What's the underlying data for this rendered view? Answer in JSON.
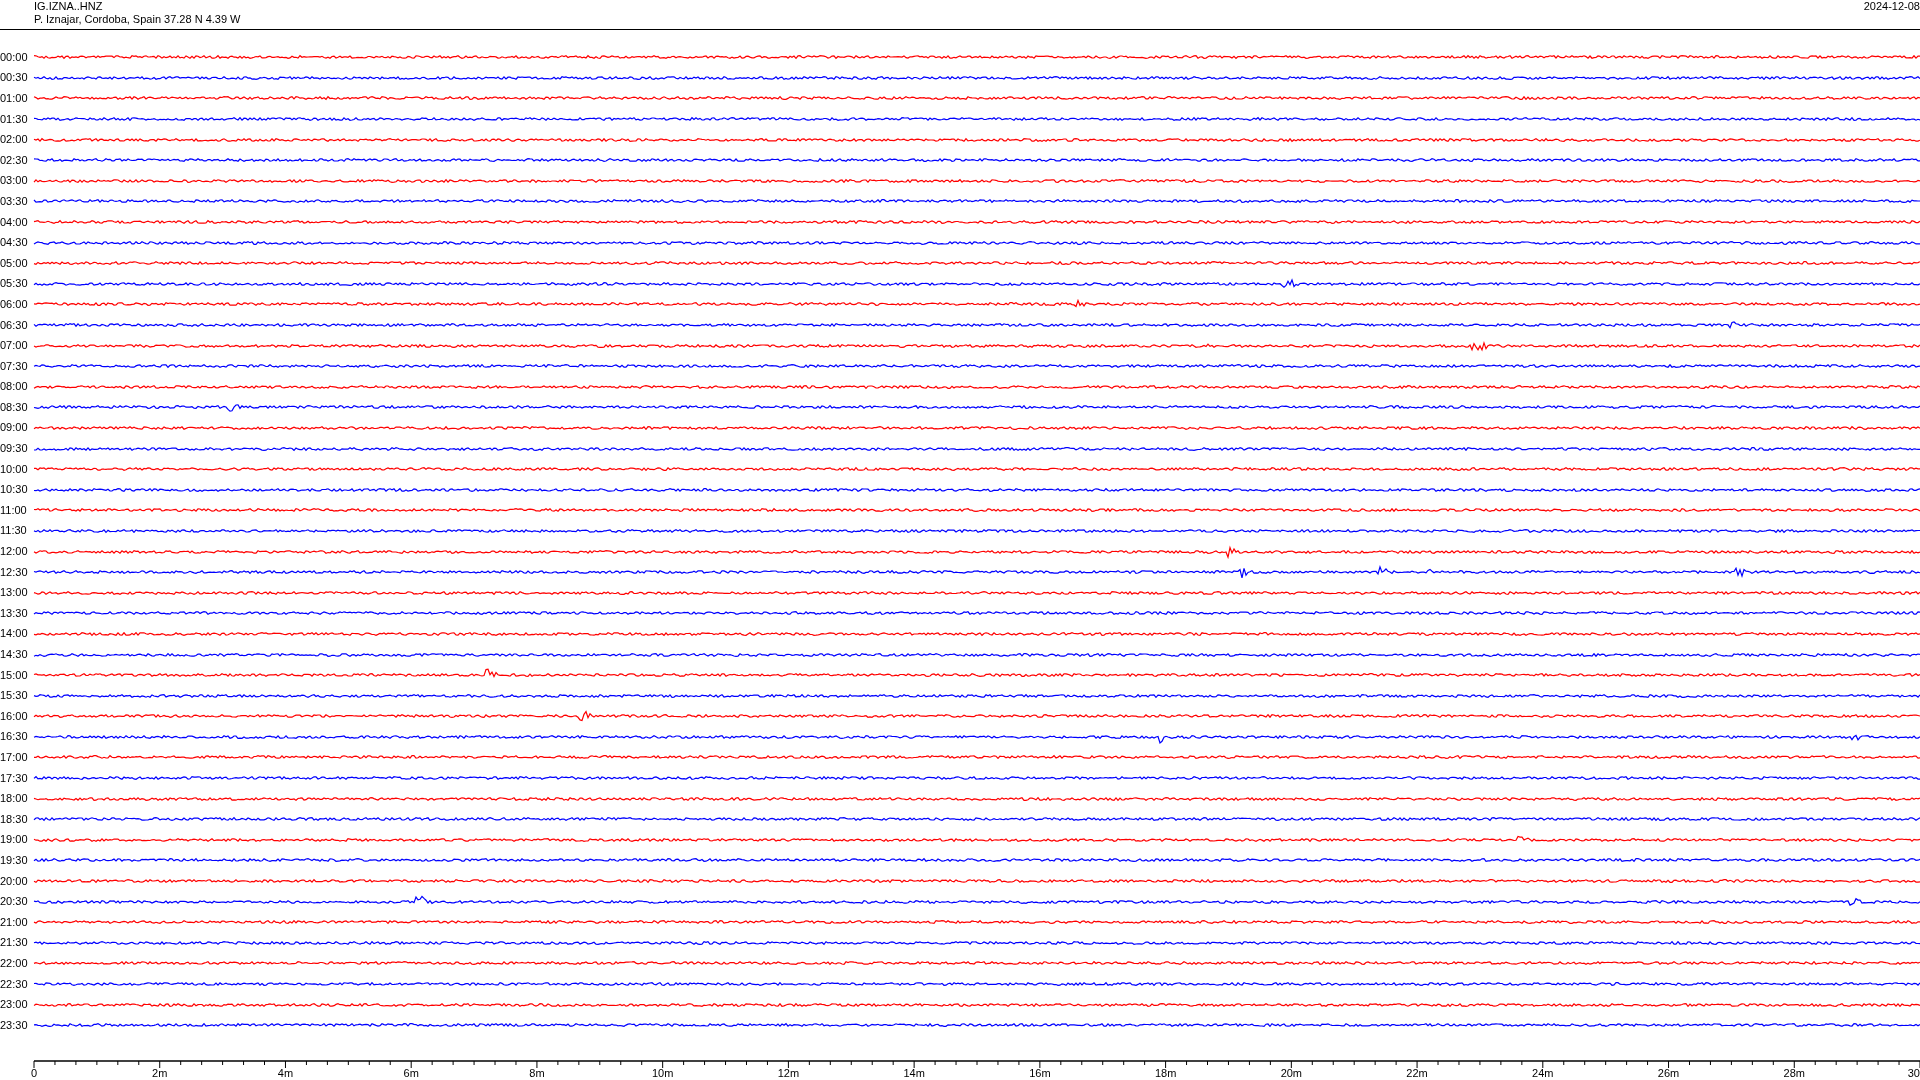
{
  "header": {
    "station": "IG.IZNA..HNZ",
    "location": "P. Iznajar, Cordoba, Spain  37.28 N 4.39 W",
    "date": "2024-12-08"
  },
  "rows": [
    {
      "label": "00:00",
      "color": "#ff0000"
    },
    {
      "label": "00:30",
      "color": "#0000ff"
    },
    {
      "label": "01:00",
      "color": "#ff0000"
    },
    {
      "label": "01:30",
      "color": "#0000ff"
    },
    {
      "label": "02:00",
      "color": "#ff0000"
    },
    {
      "label": "02:30",
      "color": "#0000ff"
    },
    {
      "label": "03:00",
      "color": "#ff0000"
    },
    {
      "label": "03:30",
      "color": "#0000ff"
    },
    {
      "label": "04:00",
      "color": "#ff0000"
    },
    {
      "label": "04:30",
      "color": "#0000ff"
    },
    {
      "label": "05:00",
      "color": "#ff0000"
    },
    {
      "label": "05:30",
      "color": "#0000ff"
    },
    {
      "label": "06:00",
      "color": "#ff0000"
    },
    {
      "label": "06:30",
      "color": "#0000ff"
    },
    {
      "label": "07:00",
      "color": "#ff0000"
    },
    {
      "label": "07:30",
      "color": "#0000ff"
    },
    {
      "label": "08:00",
      "color": "#ff0000"
    },
    {
      "label": "08:30",
      "color": "#0000ff"
    },
    {
      "label": "09:00",
      "color": "#ff0000"
    },
    {
      "label": "09:30",
      "color": "#0000ff"
    },
    {
      "label": "10:00",
      "color": "#ff0000"
    },
    {
      "label": "10:30",
      "color": "#0000ff"
    },
    {
      "label": "11:00",
      "color": "#ff0000"
    },
    {
      "label": "11:30",
      "color": "#0000ff"
    },
    {
      "label": "12:00",
      "color": "#ff0000"
    },
    {
      "label": "12:30",
      "color": "#0000ff"
    },
    {
      "label": "13:00",
      "color": "#ff0000"
    },
    {
      "label": "13:30",
      "color": "#0000ff"
    },
    {
      "label": "14:00",
      "color": "#ff0000"
    },
    {
      "label": "14:30",
      "color": "#0000ff"
    },
    {
      "label": "15:00",
      "color": "#ff0000"
    },
    {
      "label": "15:30",
      "color": "#0000ff"
    },
    {
      "label": "16:00",
      "color": "#ff0000"
    },
    {
      "label": "16:30",
      "color": "#0000ff"
    },
    {
      "label": "17:00",
      "color": "#ff0000"
    },
    {
      "label": "17:30",
      "color": "#0000ff"
    },
    {
      "label": "18:00",
      "color": "#ff0000"
    },
    {
      "label": "18:30",
      "color": "#0000ff"
    },
    {
      "label": "19:00",
      "color": "#ff0000"
    },
    {
      "label": "19:30",
      "color": "#0000ff"
    },
    {
      "label": "20:00",
      "color": "#ff0000"
    },
    {
      "label": "20:30",
      "color": "#0000ff"
    },
    {
      "label": "21:00",
      "color": "#ff0000"
    },
    {
      "label": "21:30",
      "color": "#0000ff"
    },
    {
      "label": "22:00",
      "color": "#ff0000"
    },
    {
      "label": "22:30",
      "color": "#0000ff"
    },
    {
      "label": "23:00",
      "color": "#ff0000"
    },
    {
      "label": "23:30",
      "color": "#0000ff"
    }
  ],
  "x_axis": {
    "ticks": [
      "0",
      "2m",
      "4m",
      "6m",
      "8m",
      "10m",
      "12m",
      "14m",
      "16m",
      "18m",
      "20m",
      "22m",
      "24m",
      "26m",
      "28m",
      "30"
    ]
  }
}
